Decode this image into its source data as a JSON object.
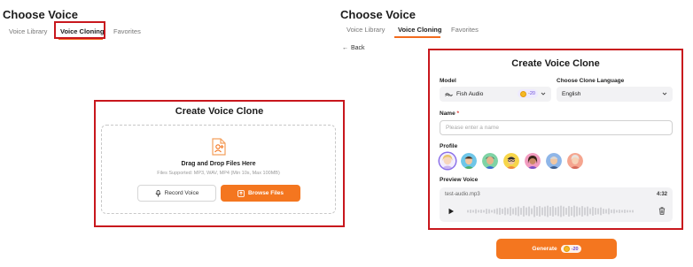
{
  "left": {
    "title": "Choose Voice",
    "tabs": [
      "Voice Library",
      "Voice Cloning",
      "Favorites"
    ],
    "card": {
      "title": "Create Voice Clone",
      "drop_title": "Drag and Drop Files Here",
      "drop_sub": "Files Supported: MP3, WAV, MP4 (Min 10s, Max 100MB)",
      "record_label": "Record Voice",
      "browse_label": "Browse Files"
    }
  },
  "right": {
    "title": "Choose Voice",
    "tabs": [
      "Voice Library",
      "Voice Cloning",
      "Favorites"
    ],
    "back_label": "Back",
    "card": {
      "title": "Create Voice Clone",
      "model_label": "Model",
      "model_value": "Fish Audio",
      "model_cost": "-20",
      "language_label": "Choose Clone Language",
      "language_value": "English",
      "name_label": "Name",
      "name_required": "*",
      "name_placeholder": "Please enter a name",
      "profile_label": "Profile",
      "preview_label": "Preview Voice",
      "preview_file": "test-audio.mp3",
      "preview_time": "4:32"
    },
    "generate_label": "Generate",
    "generate_cost": "-20"
  },
  "colors": {
    "accent": "#f4761f",
    "highlight_box": "#c8171d",
    "badge_text": "#6a4bd6"
  }
}
